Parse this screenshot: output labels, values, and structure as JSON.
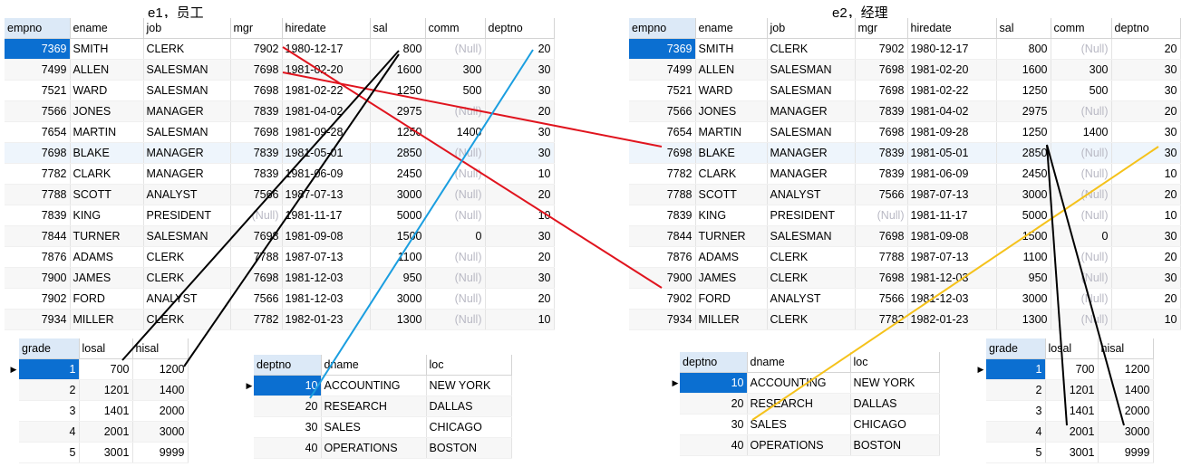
{
  "titles": {
    "left": "e1，员工",
    "right": "e2，经理"
  },
  "emp": {
    "columns": [
      "empno",
      "ename",
      "job",
      "mgr",
      "hiredate",
      "sal",
      "comm",
      "deptno"
    ],
    "rows": [
      [
        "7369",
        "SMITH",
        "CLERK",
        "7902",
        "1980-12-17",
        "800",
        "(Null)",
        "20"
      ],
      [
        "7499",
        "ALLEN",
        "SALESMAN",
        "7698",
        "1981-02-20",
        "1600",
        "300",
        "30"
      ],
      [
        "7521",
        "WARD",
        "SALESMAN",
        "7698",
        "1981-02-22",
        "1250",
        "500",
        "30"
      ],
      [
        "7566",
        "JONES",
        "MANAGER",
        "7839",
        "1981-04-02",
        "2975",
        "(Null)",
        "20"
      ],
      [
        "7654",
        "MARTIN",
        "SALESMAN",
        "7698",
        "1981-09-28",
        "1250",
        "1400",
        "30"
      ],
      [
        "7698",
        "BLAKE",
        "MANAGER",
        "7839",
        "1981-05-01",
        "2850",
        "(Null)",
        "30"
      ],
      [
        "7782",
        "CLARK",
        "MANAGER",
        "7839",
        "1981-06-09",
        "2450",
        "(Null)",
        "10"
      ],
      [
        "7788",
        "SCOTT",
        "ANALYST",
        "7566",
        "1987-07-13",
        "3000",
        "(Null)",
        "20"
      ],
      [
        "7839",
        "KING",
        "PRESIDENT",
        "(Null)",
        "1981-11-17",
        "5000",
        "(Null)",
        "10"
      ],
      [
        "7844",
        "TURNER",
        "SALESMAN",
        "7698",
        "1981-09-08",
        "1500",
        "0",
        "30"
      ],
      [
        "7876",
        "ADAMS",
        "CLERK",
        "7788",
        "1987-07-13",
        "1100",
        "(Null)",
        "20"
      ],
      [
        "7900",
        "JAMES",
        "CLERK",
        "7698",
        "1981-12-03",
        "950",
        "(Null)",
        "30"
      ],
      [
        "7902",
        "FORD",
        "ANALYST",
        "7566",
        "1981-12-03",
        "3000",
        "(Null)",
        "20"
      ],
      [
        "7934",
        "MILLER",
        "CLERK",
        "7782",
        "1982-01-23",
        "1300",
        "(Null)",
        "10"
      ]
    ]
  },
  "salgrade": {
    "columns": [
      "grade",
      "losal",
      "hisal"
    ],
    "rows": [
      [
        "1",
        "700",
        "1200"
      ],
      [
        "2",
        "1201",
        "1400"
      ],
      [
        "3",
        "1401",
        "2000"
      ],
      [
        "4",
        "2001",
        "3000"
      ],
      [
        "5",
        "3001",
        "9999"
      ]
    ]
  },
  "dept": {
    "columns": [
      "deptno",
      "dname",
      "loc"
    ],
    "rows": [
      [
        "10",
        "ACCOUNTING",
        "NEW YORK"
      ],
      [
        "20",
        "RESEARCH",
        "DALLAS"
      ],
      [
        "30",
        "SALES",
        "CHICAGO"
      ],
      [
        "40",
        "OPERATIONS",
        "BOSTON"
      ]
    ]
  },
  "colors": {
    "red": "#e0141e",
    "black": "#000000",
    "blue": "#1a9ee0",
    "yellow": "#f5c21b",
    "selected": "#0b6fd1"
  }
}
